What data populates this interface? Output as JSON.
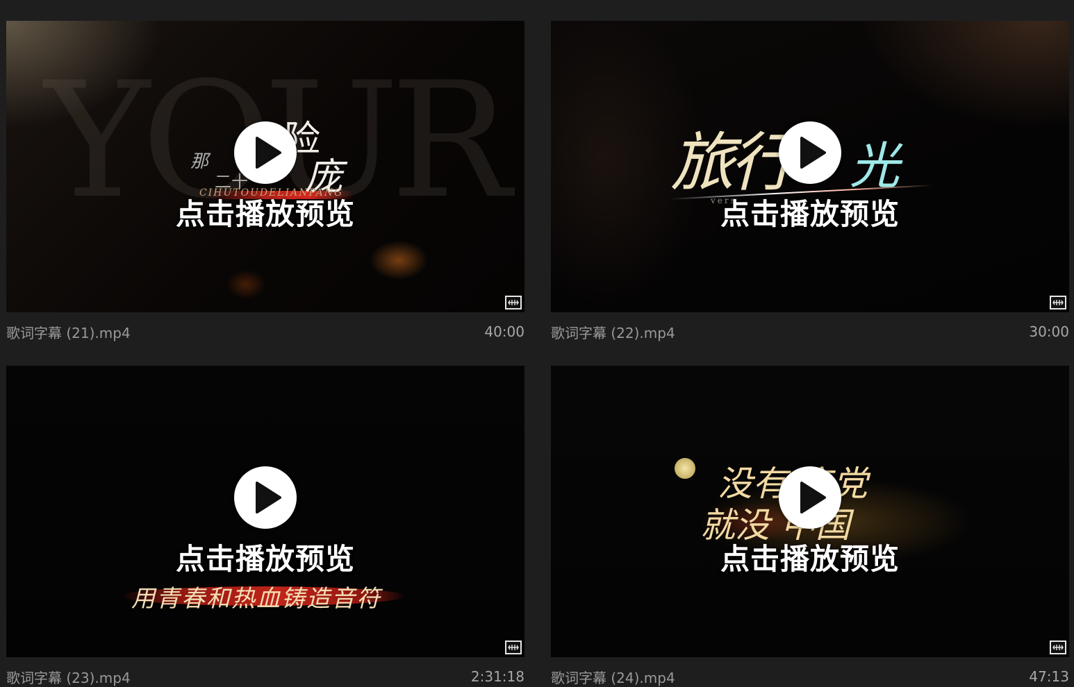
{
  "videos": [
    {
      "filename": "歌词字幕 (21).mp4",
      "duration": "40:00",
      "preview_label": "点击播放预览",
      "overlay": {
        "bg_letters": "YOUR",
        "a": "那",
        "b": "险",
        "c": "庞",
        "d": "二十",
        "e": "CIHUTOUDELIANPANG"
      }
    },
    {
      "filename": "歌词字幕 (22).mp4",
      "duration": "30:00",
      "preview_label": "点击播放预览",
      "overlay": {
        "a": "旅行",
        "b": "光",
        "c": "vers"
      }
    },
    {
      "filename": "歌词字幕 (23).mp4",
      "duration": "2:31:18",
      "preview_label": "点击播放预览",
      "overlay": {
        "a": "用青春和热血铸造音符"
      }
    },
    {
      "filename": "歌词字幕 (24).mp4",
      "duration": "47:13",
      "preview_label": "点击播放预览",
      "overlay": {
        "a": "没有 产党",
        "b": "就没 中国"
      }
    }
  ],
  "icons": {
    "play": "play-circle-icon",
    "media": "media-player-icon"
  }
}
